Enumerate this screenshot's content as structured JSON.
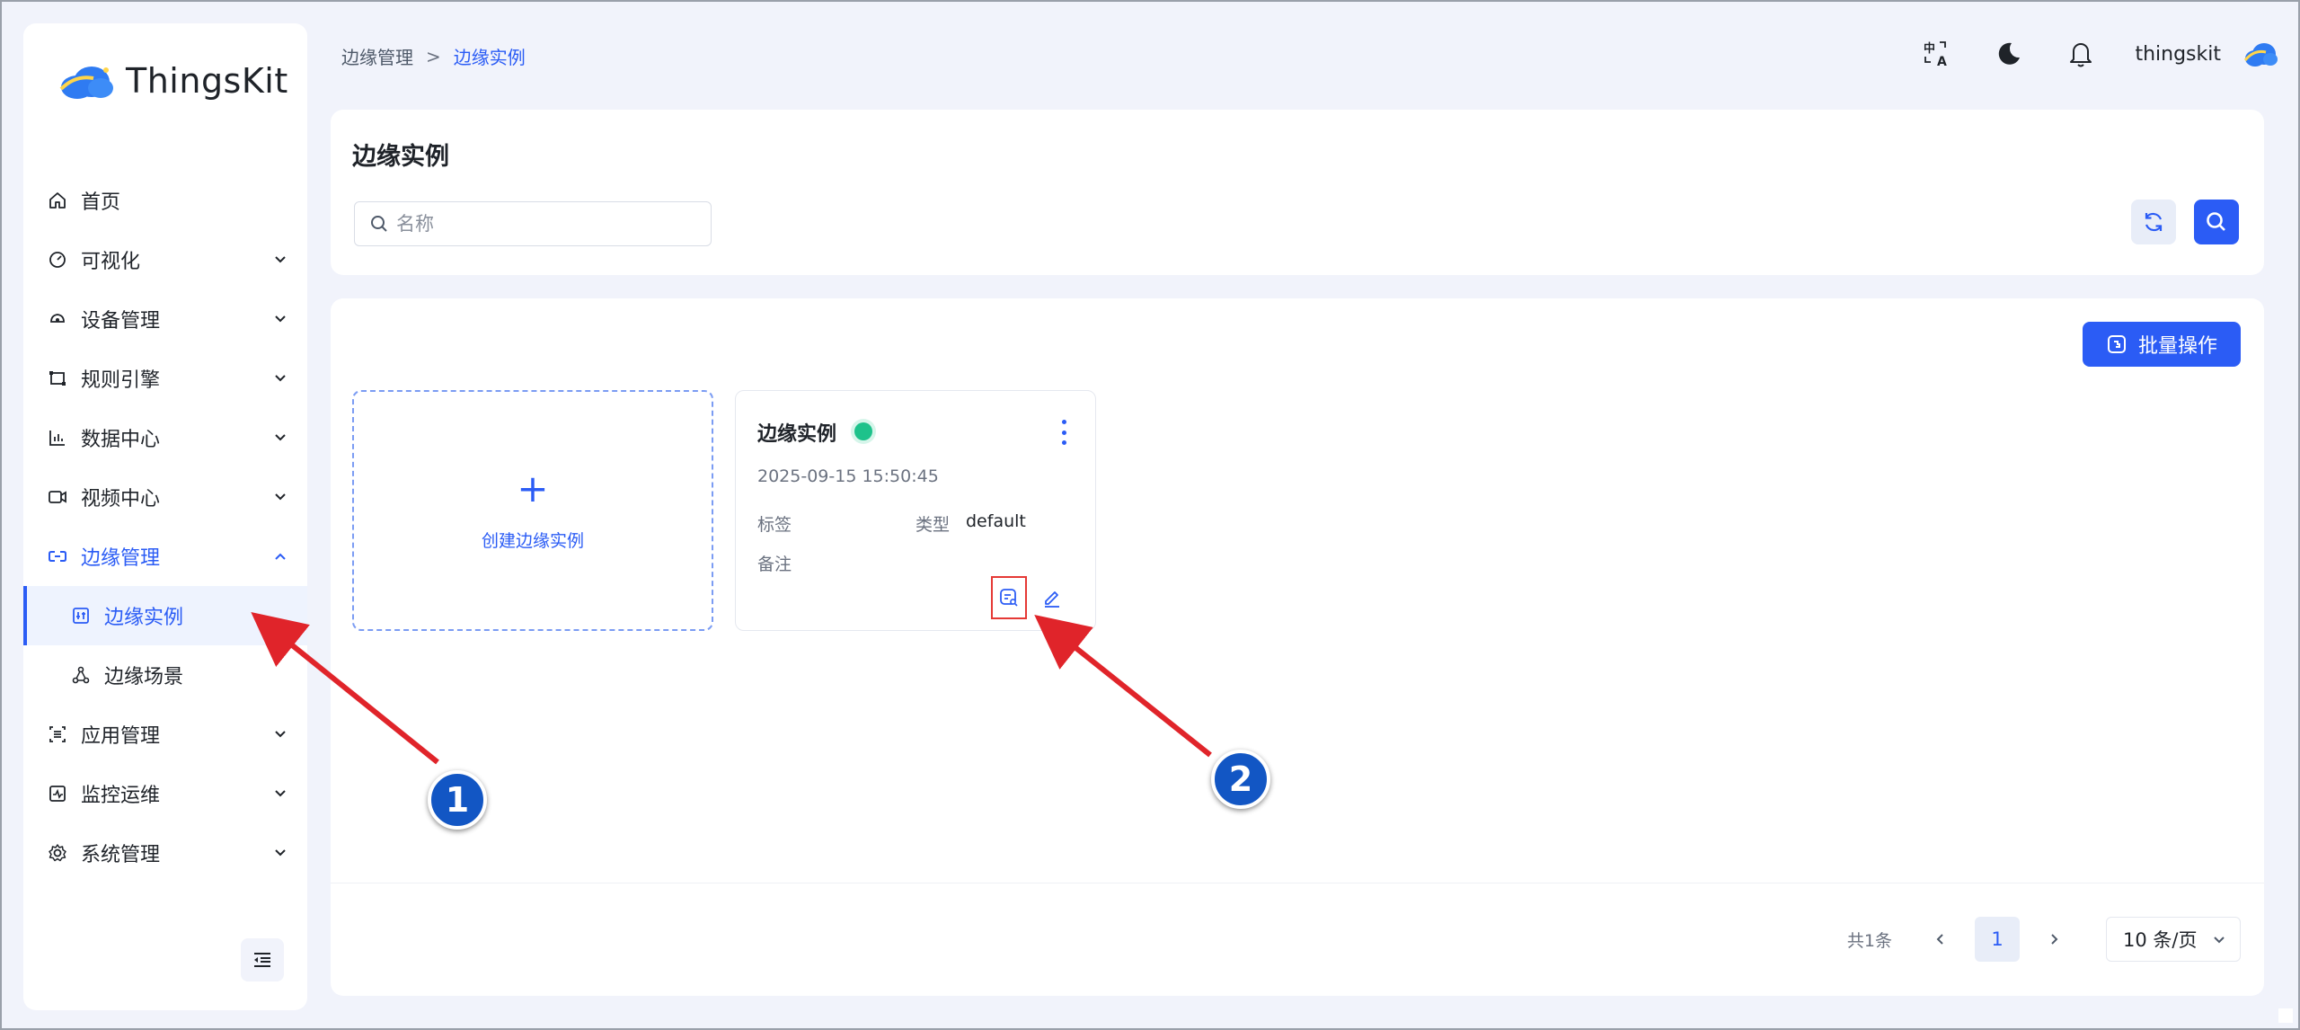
{
  "app": {
    "name": "ThingsKit"
  },
  "breadcrumb": {
    "parent": "边缘管理",
    "separator": ">",
    "current": "边缘实例"
  },
  "header": {
    "username": "thingskit",
    "translate_icon": "translate-icon",
    "theme_icon": "moon-icon",
    "notify_icon": "bell-icon"
  },
  "sidebar": {
    "items": [
      {
        "label": "首页",
        "icon": "home-icon"
      },
      {
        "label": "可视化",
        "icon": "dashboard-icon"
      },
      {
        "label": "设备管理",
        "icon": "device-icon"
      },
      {
        "label": "规则引擎",
        "icon": "rule-icon"
      },
      {
        "label": "数据中心",
        "icon": "chart-icon"
      },
      {
        "label": "视频中心",
        "icon": "video-icon"
      },
      {
        "label": "边缘管理",
        "icon": "edge-icon"
      },
      {
        "label": "边缘实例",
        "icon": "instance-icon"
      },
      {
        "label": "边缘场景",
        "icon": "scene-icon"
      },
      {
        "label": "应用管理",
        "icon": "app-icon"
      },
      {
        "label": "监控运维",
        "icon": "monitor-icon"
      },
      {
        "label": "系统管理",
        "icon": "settings-icon"
      }
    ]
  },
  "search": {
    "title": "边缘实例",
    "placeholder": "名称"
  },
  "content": {
    "batch_label": "批量操作",
    "create_label": "创建边缘实例",
    "card": {
      "title": "边缘实例",
      "status": "online",
      "status_color": "#1ec28b",
      "time": "2025-09-15 15:50:45",
      "tag_label": "标签",
      "type_label": "类型",
      "type_value": "default",
      "note_label": "备注"
    }
  },
  "pagination": {
    "total": "共1条",
    "current_page": "1",
    "page_size": "10 条/页"
  },
  "annotations": {
    "badge1": "1",
    "badge2": "2"
  },
  "colors": {
    "accent": "#2b5cf5",
    "annotation_arrow": "#e0242a",
    "badge": "#1256c4"
  }
}
